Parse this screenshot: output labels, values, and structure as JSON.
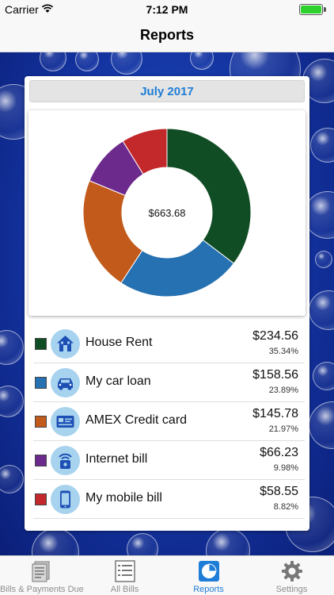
{
  "status_bar": {
    "carrier": "Carrier",
    "time": "7:12 PM",
    "wifi_icon": "wifi-icon",
    "battery_icon": "battery-icon"
  },
  "nav": {
    "title": "Reports"
  },
  "report": {
    "month": "July 2017",
    "total": "$663.68",
    "colors": {
      "accent": "#1e7dd6",
      "icon_bg": "#a7d3ef"
    }
  },
  "chart_data": {
    "type": "pie",
    "title": "",
    "categories": [
      "House Rent",
      "My car loan",
      "AMEX Credit card",
      "Internet bill",
      "My mobile bill"
    ],
    "values": [
      234.56,
      158.56,
      145.78,
      66.23,
      58.55
    ],
    "percentages": [
      35.34,
      23.89,
      21.97,
      9.98,
      8.82
    ],
    "colors": [
      "#114d24",
      "#2671b2",
      "#c25a1c",
      "#6c2a8d",
      "#c3282a"
    ],
    "center_label": "$663.68",
    "legend_placement": "below"
  },
  "bills": [
    {
      "label": "House Rent",
      "amount": "$234.56",
      "percent": "35.34%",
      "color": "#114d24",
      "icon": "house-icon"
    },
    {
      "label": "My car loan",
      "amount": "$158.56",
      "percent": "23.89%",
      "color": "#2671b2",
      "icon": "car-icon"
    },
    {
      "label": "AMEX Credit card",
      "amount": "$145.78",
      "percent": "21.97%",
      "color": "#c25a1c",
      "icon": "credit-card-icon"
    },
    {
      "label": "Internet bill",
      "amount": "$66.23",
      "percent": "9.98%",
      "color": "#6c2a8d",
      "icon": "wifi-router-icon"
    },
    {
      "label": "My mobile bill",
      "amount": "$58.55",
      "percent": "8.82%",
      "color": "#c3282a",
      "icon": "mobile-phone-icon"
    }
  ],
  "tabs": [
    {
      "label": "Bills & Payments Due",
      "icon": "bills-stack-icon"
    },
    {
      "label": "All Bills",
      "icon": "list-icon"
    },
    {
      "label": "Reports",
      "icon": "pie-chart-icon",
      "active": true
    },
    {
      "label": "Settings",
      "icon": "gear-icon"
    }
  ]
}
